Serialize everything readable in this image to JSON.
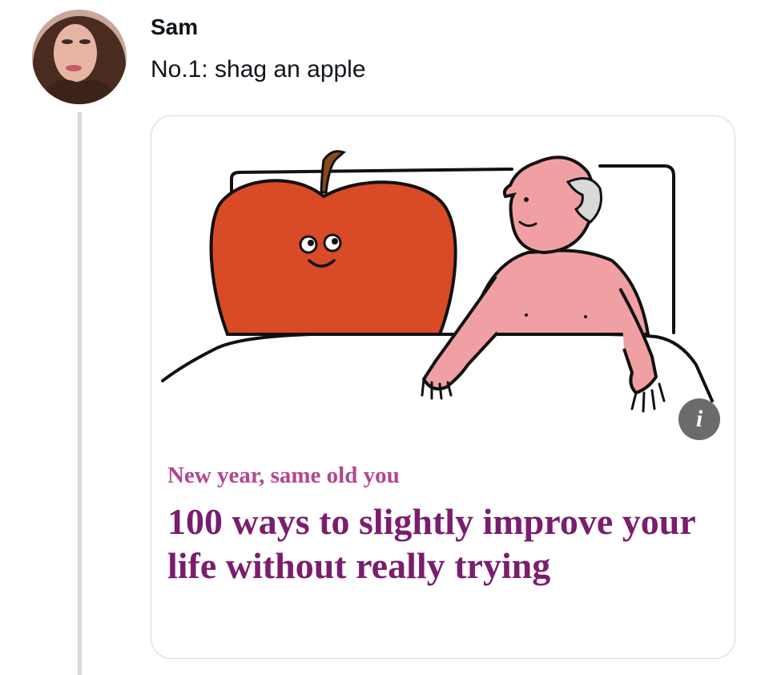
{
  "tweet": {
    "author_name": "Sam",
    "text": "No.1: shag an apple"
  },
  "card": {
    "kicker": "New year, same old you",
    "headline": "100 ways to slightly improve your life without really trying",
    "info_icon": "i"
  },
  "colors": {
    "kicker": "#b3478f",
    "headline": "#7a1d6e",
    "apple": "#d94a26",
    "skin": "#f0a0a3",
    "thread_line": "#cfd9de"
  }
}
